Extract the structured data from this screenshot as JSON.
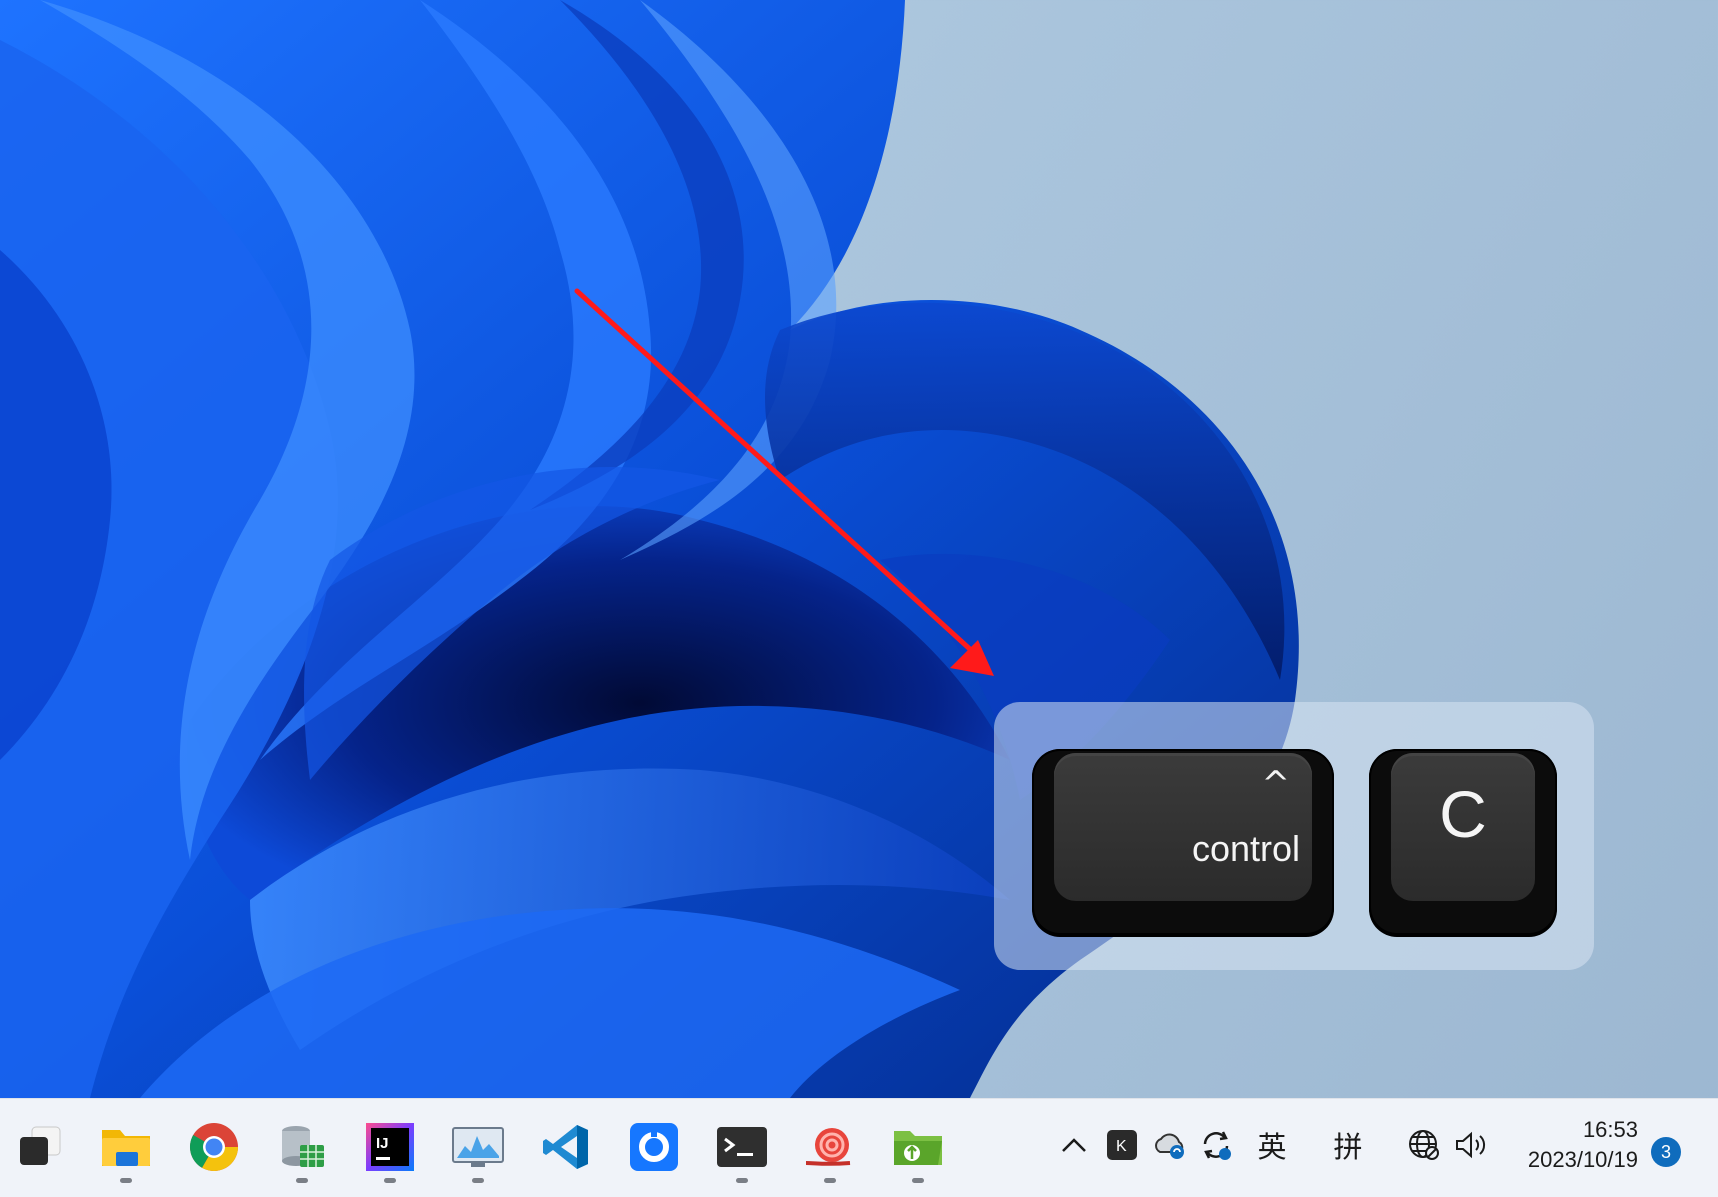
{
  "overlay": {
    "key1": {
      "symbol": "^",
      "label": "control"
    },
    "key2": {
      "label": "C"
    }
  },
  "taskbar": {
    "apps": [
      {
        "name": "Show desktop",
        "icon": "show-desktop-icon",
        "running": false
      },
      {
        "name": "File Explorer",
        "icon": "folder-icon",
        "running": true
      },
      {
        "name": "Google Chrome",
        "icon": "chrome-icon",
        "running": false
      },
      {
        "name": "Database tool",
        "icon": "database-icon",
        "running": true
      },
      {
        "name": "IntelliJ IDEA",
        "icon": "intellij-icon",
        "running": true
      },
      {
        "name": "Performance monitor",
        "icon": "monitor-chart-icon",
        "running": true
      },
      {
        "name": "Visual Studio Code",
        "icon": "vscode-icon",
        "running": false
      },
      {
        "name": "Blue circle app",
        "icon": "blue-ring-icon",
        "running": false
      },
      {
        "name": "Terminal",
        "icon": "terminal-icon",
        "running": true
      },
      {
        "name": "Snail app",
        "icon": "snail-icon",
        "running": true
      },
      {
        "name": "Green folder app",
        "icon": "green-folder-icon",
        "running": true
      }
    ],
    "tray": {
      "ime_lang": "英",
      "ime_mode": "拼",
      "time": "16:53",
      "date": "2023/10/19",
      "notifications": "3"
    }
  },
  "colors": {
    "wallpaper_blue": "#0a50e0",
    "arrow": "#ff1a1a",
    "taskbar_bg": "#f0f3f9",
    "badge": "#0f6cbd"
  }
}
